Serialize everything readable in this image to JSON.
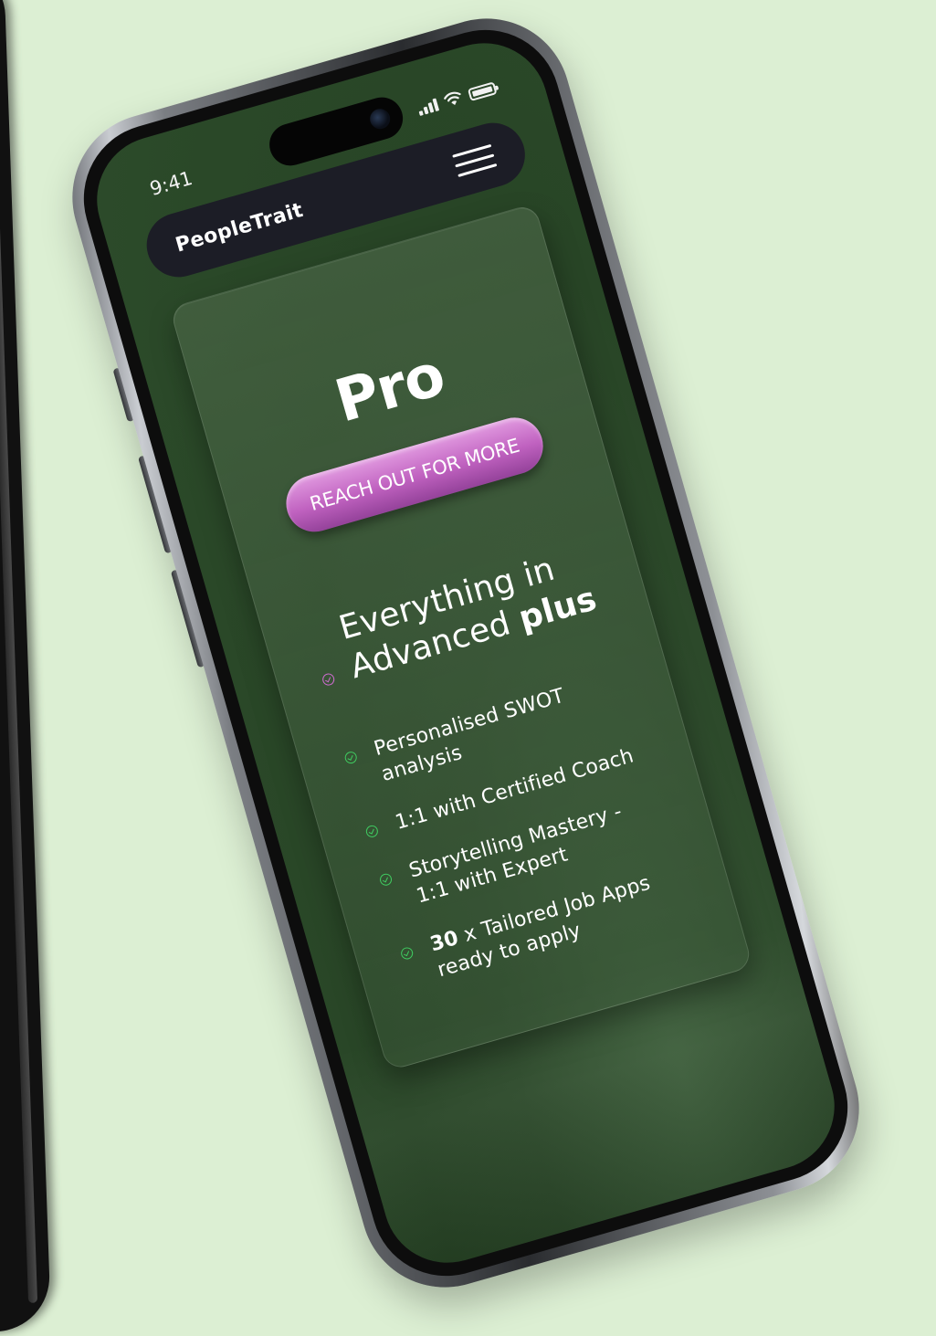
{
  "status_bar": {
    "time": "9:41",
    "icons": [
      "signal-icon",
      "wifi-icon",
      "battery-icon"
    ]
  },
  "navbar": {
    "brand": "PeopleTrait",
    "menu_icon": "hamburger-menu-icon"
  },
  "plan": {
    "title": "Pro",
    "cta_label": "REACH OUT FOR MORE",
    "headline": {
      "line1": "Everything in",
      "line2_prefix": "Advanced ",
      "line2_bold": "plus"
    },
    "features": [
      {
        "bold": "",
        "text": "Personalised SWOT analysis"
      },
      {
        "bold": "",
        "text": "1:1 with Certified Coach"
      },
      {
        "bold": "",
        "text": "Storytelling Mastery - 1:1 with Expert"
      },
      {
        "bold": "30",
        "text": " x Tailored Job Apps ready to apply"
      }
    ]
  },
  "colors": {
    "page_background": "#dcefd3",
    "screen_green": "#2d4a2b",
    "navbar": "#1c1d26",
    "cta_pink": "#c062c0",
    "check_green": "#3fcb60",
    "check_pink": "#cf6bd0"
  }
}
